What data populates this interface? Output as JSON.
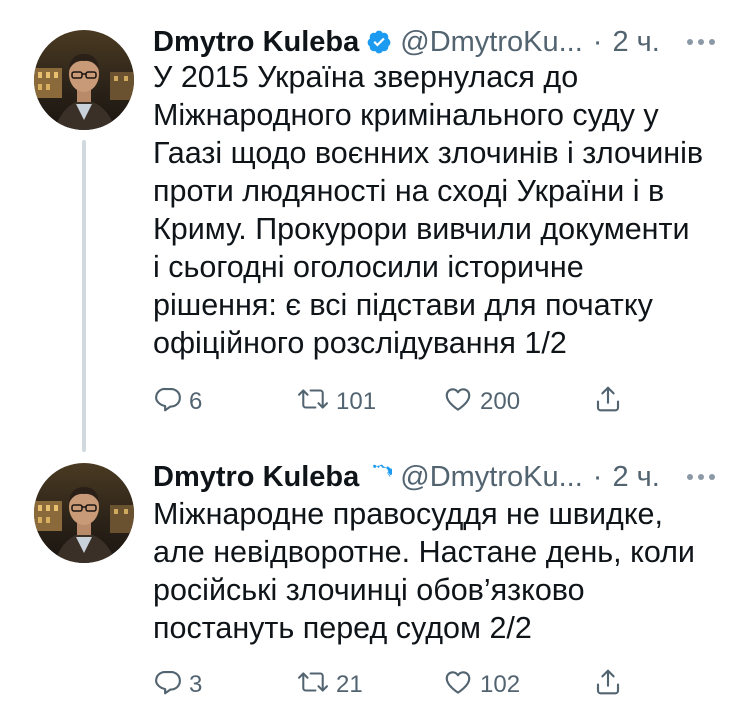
{
  "colors": {
    "text_primary": "#0f1419",
    "text_secondary": "#536471",
    "verified_blue": "#1d9bf0",
    "thread_line": "#cfd9de"
  },
  "icons": {
    "verified": "verified-badge-icon",
    "more": "more-dots-icon",
    "reply": "reply-icon",
    "retweet": "retweet-icon",
    "like": "heart-icon",
    "share": "share-icon"
  },
  "tweets": [
    {
      "author_name": "Dmytro Kuleba",
      "handle": "@DmytroKu...",
      "separator": "·",
      "time": "2 ч.",
      "text": "У 2015 Україна звернулася до\nМіжнародного кримінального суду у\nГаазі щодо воєнних злочинів і злочинів\nпроти людяності на сході України і в\nКриму. Прокурори вивчили документи\nі сьогодні оголосили історичне\nрішення: є всі підстави для початку\nофіційного розслідування 1/2",
      "reply_count": "6",
      "retweet_count": "101",
      "like_count": "200"
    },
    {
      "author_name": "Dmytro Kuleba",
      "handle": "@DmytroKu...",
      "separator": "·",
      "time": "2 ч.",
      "text": "Міжнародне правосуддя не швидке,\nале невідворотне. Настане день, коли\nросійські злочинці обов’язково\nпостануть перед судом 2/2",
      "reply_count": "3",
      "retweet_count": "21",
      "like_count": "102"
    }
  ]
}
